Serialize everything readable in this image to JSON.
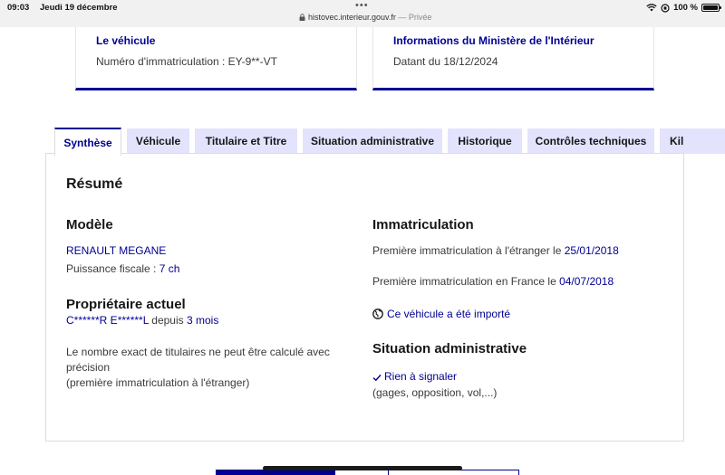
{
  "statusbar": {
    "time": "09:03",
    "date": "Jeudi 19 décembre",
    "dots": "•••",
    "url": "histovec.interieur.gouv.fr",
    "private_suffix": " — Privée",
    "battery": "100 %"
  },
  "cards": [
    {
      "title": "Le véhicule",
      "text": "Numéro d'immatriculation : EY-9**-VT"
    },
    {
      "title": "Informations du Ministère de l'Intérieur",
      "text": "Datant du 18/12/2024"
    }
  ],
  "tabs": [
    {
      "label": "Synthèse",
      "active": true
    },
    {
      "label": "Véhicule"
    },
    {
      "label": "Titulaire et Titre"
    },
    {
      "label": "Situation administrative"
    },
    {
      "label": "Historique"
    },
    {
      "label": "Contrôles techniques"
    },
    {
      "label": "Kil"
    }
  ],
  "summary": {
    "heading": "Résumé",
    "modele": {
      "heading": "Modèle",
      "name": "RENAULT MEGANE",
      "puissance_label": "Puissance fiscale : ",
      "puissance_value": "7 ch"
    },
    "proprietaire": {
      "heading": "Propriétaire actuel",
      "name": "C******R E******L",
      "depuis_label": " depuis ",
      "depuis_value": "3 mois",
      "note_line1": "Le nombre exact de titulaires ne peut être calculé avec",
      "note_line2": "précision",
      "note_line3": "(première immatriculation à l'étranger)"
    },
    "immatriculation": {
      "heading": "Immatriculation",
      "etranger_label": "Première immatriculation à l'étranger le ",
      "etranger_date": "25/01/2018",
      "france_label": "Première immatriculation en France le ",
      "france_date": "04/07/2018",
      "importe": "Ce véhicule a été importé"
    },
    "situation": {
      "heading": "Situation administrative",
      "status": "Rien à signaler",
      "detail": "(gages, opposition, vol,...)"
    }
  },
  "colors": {
    "primary": "#000091",
    "tab_bg": "#e3e3fd",
    "text": "#3a3a3a"
  }
}
